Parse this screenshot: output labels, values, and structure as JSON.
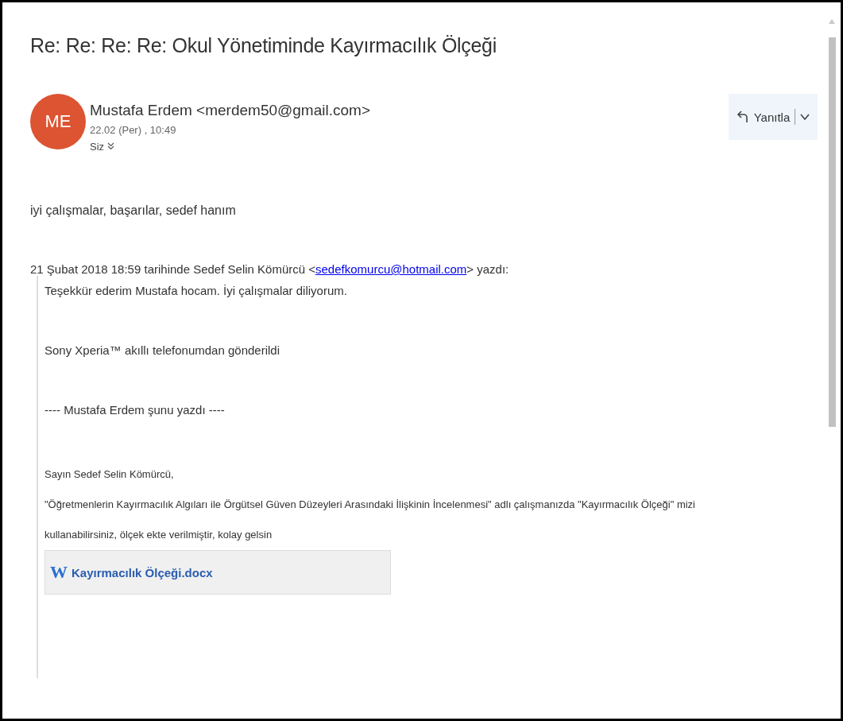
{
  "subject": "Re: Re: Re: Re: Okul Yönetiminde Kayırmacılık Ölçeği",
  "sender": {
    "initials": "ME",
    "name": "Mustafa Erdem <merdem50@gmail.com>",
    "date": "22.02 (Per) , 10:49",
    "recipient": "Siz"
  },
  "reply_button": {
    "label": "Yanıtla"
  },
  "body": "iyi çalışmalar, başarılar, sedef hanım",
  "quote_header": {
    "before": "21 Şubat 2018 18:59 tarihinde Sedef Selin Kömürcü <",
    "link": "sedefkomurcu@hotmail.com",
    "after": "> yazdı:"
  },
  "quoted": [
    {
      "lines": [
        "Teşekkür ederim Mustafa hocam. İyi çalışmalar diliyorum."
      ]
    },
    {
      "lines": [
        "Sony Xperia™ akıllı telefonumdan gönderildi"
      ]
    },
    {
      "lines": [
        "---- Mustafa Erdem şunu yazdı ----"
      ]
    },
    {
      "lines": [
        "Sayın Sedef Selin Kömürcü,",
        "\"Öğretmenlerin Kayırmacılık Algıları ile Örgütsel Güven Düzeyleri Arasındaki İlişkinin İncelenmesi\" adlı çalışmanızda \"Kayırmacılık Ölçeği\" mizi kullanabilirsiniz, ölçek ekte verilmiştir, kolay gelsin"
      ]
    }
  ],
  "attachment": {
    "icon": "W",
    "name": "Kayırmacılık Ölçeği.docx"
  }
}
